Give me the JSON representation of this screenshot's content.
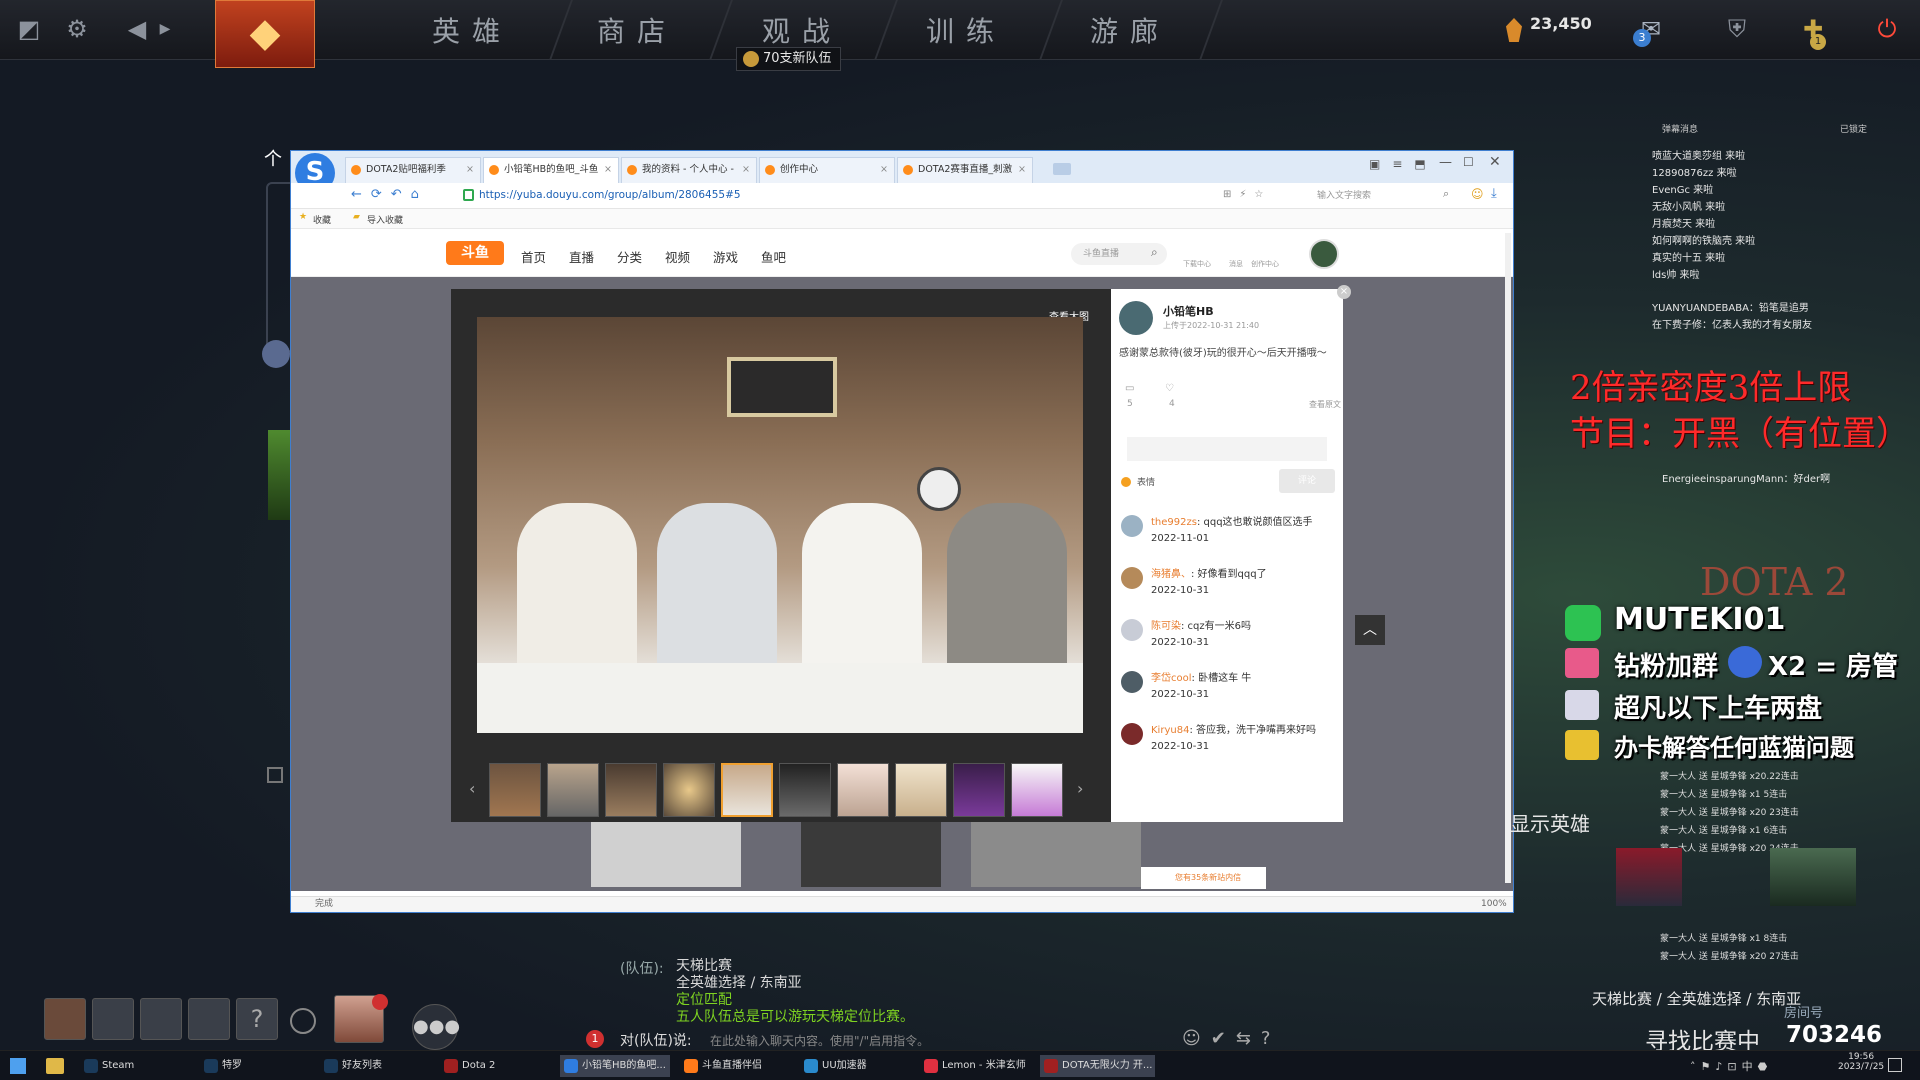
{
  "game": {
    "nav": [
      "英雄",
      "商店",
      "观战",
      "训练",
      "游廊"
    ],
    "notice": "70支新队伍",
    "shards": "23,450",
    "badge_count": "3",
    "hero_badge": "1"
  },
  "browser": {
    "tabs": [
      "DOTA2贴吧福利季",
      "小铅笔HB的鱼吧_斗鱼",
      "我的资料 - 个人中心 - ",
      "创作中心",
      "DOTA2赛事直播_刺激"
    ],
    "url": "https://yuba.douyu.com/group/album/2806455#5",
    "search_placeholder": "输入文字搜索",
    "bookmarks": [
      "收藏",
      "导入收藏"
    ],
    "status": "完成",
    "zoom": "100%"
  },
  "site": {
    "logo": "斗鱼",
    "nav": [
      "首页",
      "直播",
      "分类",
      "视频",
      "游戏",
      "鱼吧"
    ],
    "search_placeholder": "斗鱼直播",
    "icon_labels": [
      "下载中心",
      "消息",
      "创作中心"
    ]
  },
  "modal": {
    "view_large": "查看大图",
    "author": "小铅笔HB",
    "posted": "上传于2022-10-31 21:40",
    "body": "感谢蒙总款待(彼牙)玩的很开心～后天开播哦～",
    "stats": {
      "comments": "5",
      "likes": "4",
      "share_label": "查看原文"
    },
    "emoji_label": "表情",
    "reply_btn": "评论",
    "comments": [
      {
        "name": "the992zs",
        "text": ": qqq这也敢说颜值区选手",
        "date": "2022-11-01"
      },
      {
        "name": "海猪鼻、",
        "text": ": 好像看到qqq了",
        "date": "2022-10-31"
      },
      {
        "name": "陈可染",
        "text": ": cqz有一米6吗",
        "date": "2022-10-31"
      },
      {
        "name": "李岱cool",
        "text": ": 卧槽这车 牛",
        "date": "2022-10-31"
      },
      {
        "name": "Kiryu84",
        "text": ": 答应我，洗干净嘴再来好吗",
        "date": "2022-10-31"
      }
    ],
    "notify": "您有35条新站内信"
  },
  "overlay": {
    "danmaku_title": "弹幕消息",
    "danmaku_lock": "已锁定",
    "danmaku": [
      "喷蓝大道奥莎组 来啦",
      "12890876zz 来啦",
      "EvenGc 来啦",
      "无敌小风帆 来啦",
      "月痕焚天 来啦",
      "如何啊啊的铁脑壳 来啦",
      "真实的十五 来啦",
      "lds帅 来啦"
    ],
    "chat_lines": [
      "YUANYUANDEBABA：铅笔是追男",
      "在下费子修：亿表人我的才有女朋友",
      "EnergieeinsparungMann：好der啊"
    ],
    "red_line1": "2倍亲密度3倍上限",
    "red_line2": "节目：开黑（有位置）",
    "promo": [
      "MUTEKI01",
      "钻粉加群",
      "X2 = 房管",
      "超凡以下上车两盘",
      "办卡解答任何蓝猫问题"
    ],
    "gift_prefix": "蒙一大人 送 星城争锋",
    "gift_counts": [
      "x20.22连击",
      "x1 5连击",
      "x20 23连击",
      "x1 6连击",
      "x20 24连击",
      "x1 8连击",
      "x20 27连击"
    ],
    "ladder": "天梯比赛 / 全英雄选择 / 东南亚",
    "room_label": "房间号",
    "room": "703246",
    "finding": "寻找比赛中",
    "show_hero": "显示英雄",
    "dota_brand": "DOTA 2"
  },
  "chat": {
    "party_label": "(队伍):",
    "lines": [
      "天梯比赛",
      "全英雄选择 / 东南亚",
      "定位匹配",
      "五人队伍总是可以游玩天梯定位比赛。"
    ],
    "input_prefix": "对(队伍)说:",
    "input_placeholder": "在此处输入聊天内容。使用\"/\"启用指令。",
    "unread": "1"
  },
  "taskbar": {
    "items": [
      "Steam",
      "特罗",
      "好友列表",
      "Dota 2",
      "小铅笔HB的鱼吧...",
      "斗鱼直播伴侣",
      "UU加速器",
      "Lemon - 米津玄师",
      "DOTA无限火力 开..."
    ],
    "time": "19:56",
    "date": "2023/7/25"
  }
}
